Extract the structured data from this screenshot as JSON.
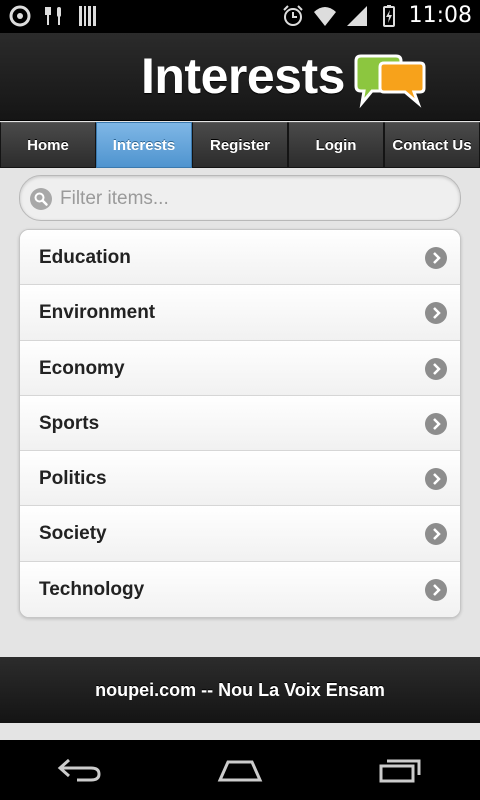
{
  "status_bar": {
    "time": "11:08",
    "left_icons": [
      "gear-icon",
      "utensils-icon",
      "barcode-icon"
    ],
    "right_icons": [
      "alarm-icon",
      "wifi-icon",
      "signal-icon",
      "battery-icon"
    ]
  },
  "header": {
    "title": "Interests"
  },
  "nav": {
    "items": [
      {
        "label": "Home",
        "active": false
      },
      {
        "label": "Interests",
        "active": true
      },
      {
        "label": "Register",
        "active": false
      },
      {
        "label": "Login",
        "active": false
      },
      {
        "label": "Contact Us",
        "active": false
      }
    ]
  },
  "search": {
    "placeholder": "Filter items...",
    "value": ""
  },
  "list": {
    "items": [
      {
        "label": "Education"
      },
      {
        "label": "Environment"
      },
      {
        "label": "Economy"
      },
      {
        "label": "Sports"
      },
      {
        "label": "Politics"
      },
      {
        "label": "Society"
      },
      {
        "label": "Technology"
      }
    ]
  },
  "footer": {
    "text": "noupei.com -- Nou La Voix Ensam"
  },
  "colors": {
    "accent": "#5a9fd8",
    "logo_green": "#8cc63f",
    "logo_orange": "#f7a21b"
  }
}
